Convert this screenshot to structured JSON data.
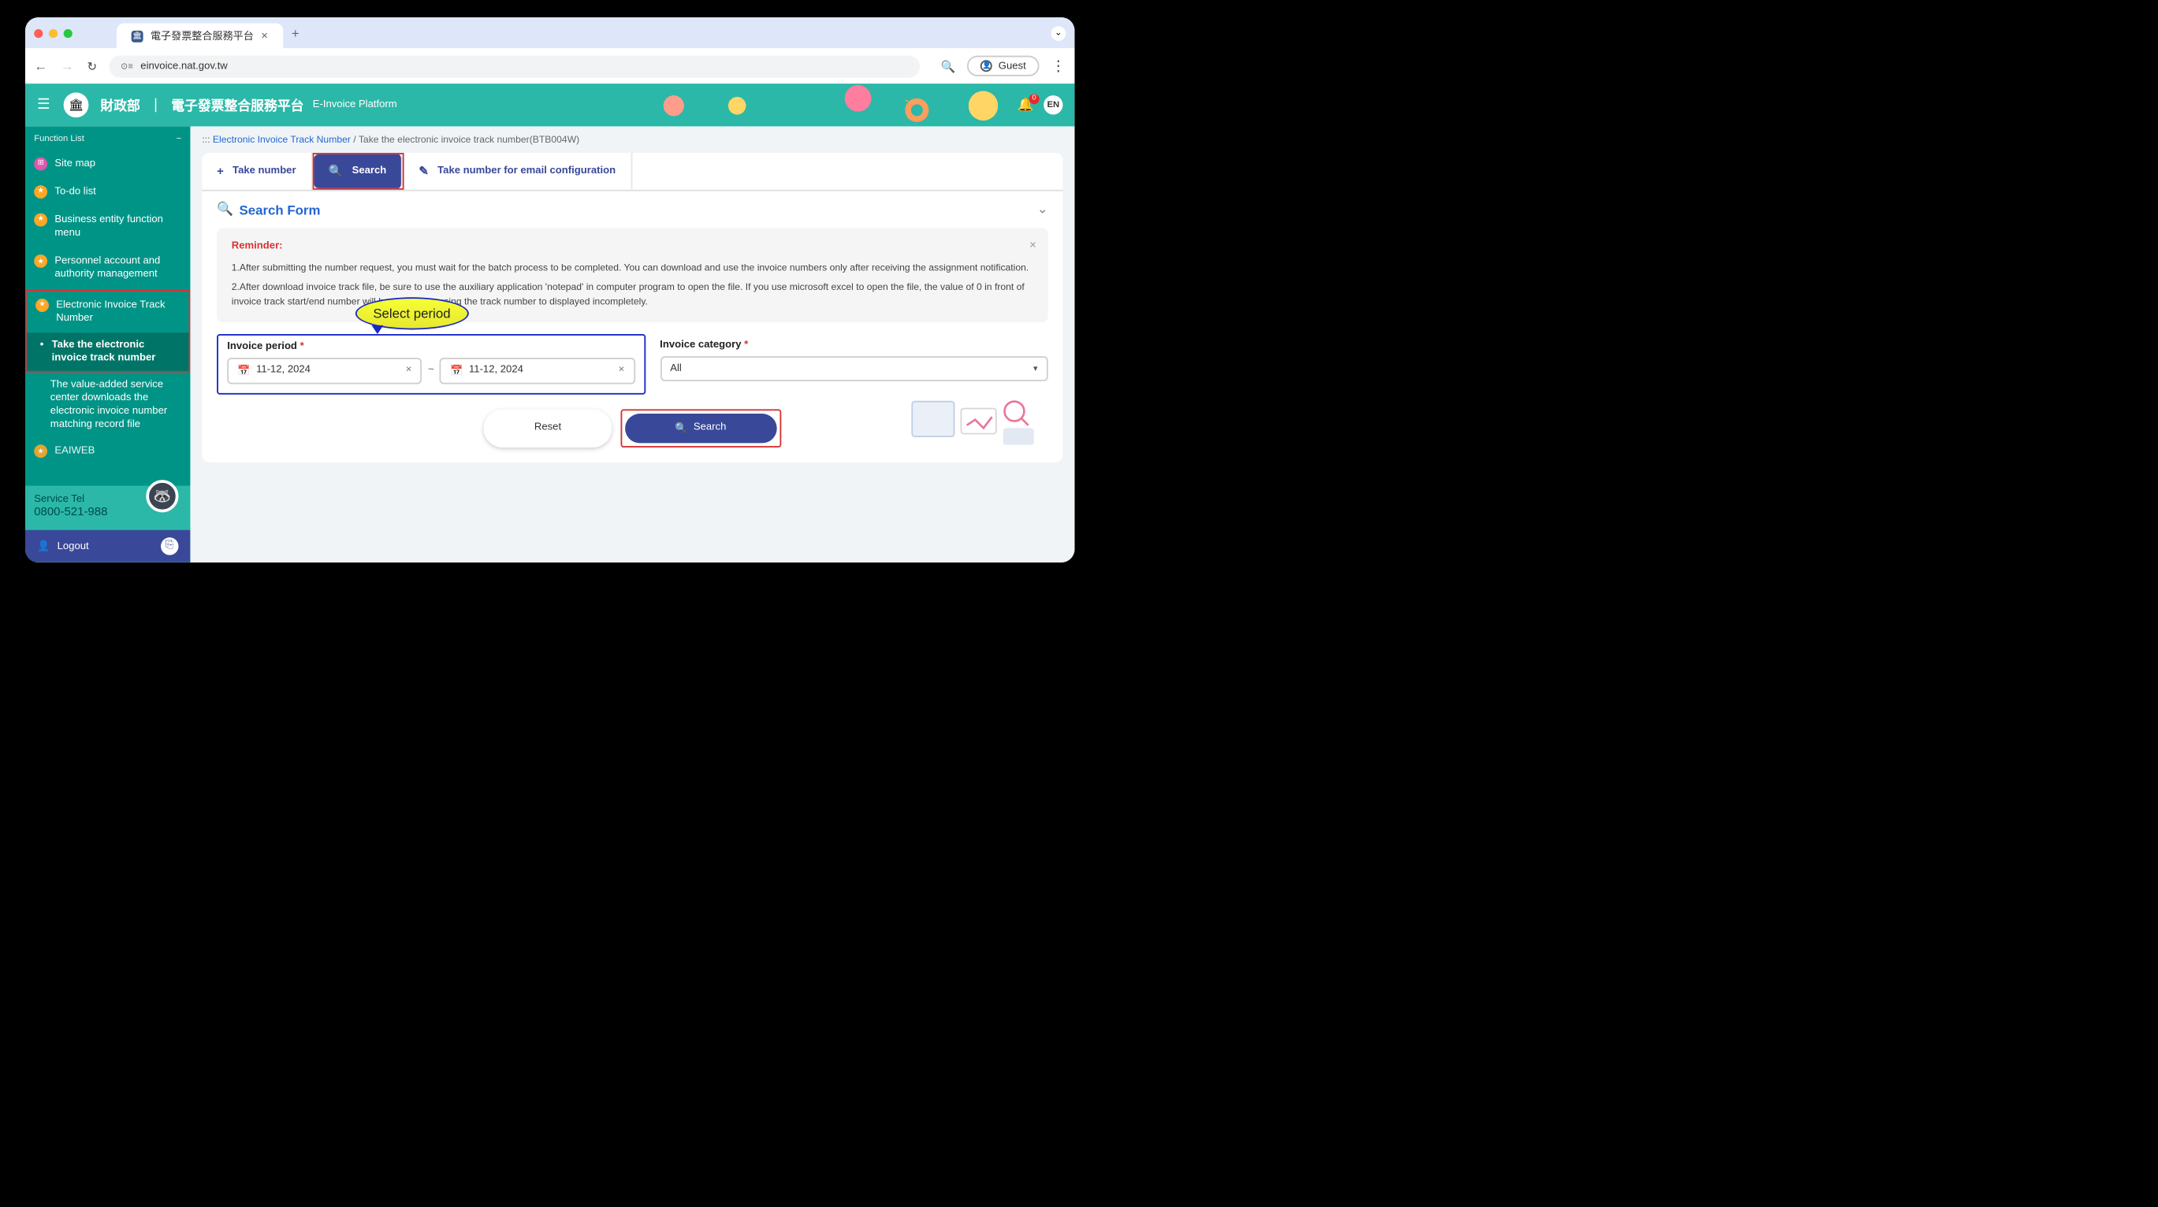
{
  "browser": {
    "tab_title": "電子發票整合服務平台",
    "url": "einvoice.nat.gov.tw",
    "guest_label": "Guest"
  },
  "header": {
    "brand_cn1": "財政部",
    "brand_cn2": "電子發票整合服務平台",
    "brand_en": "E-Invoice Platform",
    "lang": "EN",
    "notif_count": "0"
  },
  "sidebar": {
    "title": "Function List",
    "items": [
      {
        "label": "Site map"
      },
      {
        "label": "To-do list"
      },
      {
        "label": "Business entity function menu"
      },
      {
        "label": "Personnel account and authority management"
      },
      {
        "label": "Electronic Invoice Track Number",
        "children": [
          {
            "label": "Take the electronic invoice track number"
          },
          {
            "label": "The value-added service center downloads the electronic invoice number matching record file"
          }
        ]
      },
      {
        "label": "EAIWEB"
      }
    ],
    "service_label": "Service Tel",
    "service_num": "0800-521-988",
    "logout": "Logout"
  },
  "breadcrumb": {
    "prefix": ":::",
    "link": "Electronic Invoice Track Number",
    "sep": "/",
    "current": "Take the electronic invoice track number(BTB004W)"
  },
  "tabs": {
    "take": "Take number",
    "search": "Search",
    "email": "Take number for email configuration"
  },
  "section": {
    "title": "Search Form"
  },
  "reminder": {
    "title": "Reminder:",
    "line1": "1.After submitting the number request, you must wait for the batch process to be completed. You can download and use the invoice numbers only after receiving the assignment notification.",
    "line2": "2.After download invoice track file, be sure to use the auxiliary application 'notepad' in computer program to open the file. If you use microsoft excel to open the file, the value of 0 in front of invoice track start/end number will be omitted, causing the track number to displayed incompletely."
  },
  "form": {
    "period_label": "Invoice period",
    "period_from": "11-12, 2024",
    "period_to": "11-12, 2024",
    "category_label": "Invoice category",
    "category_value": "All",
    "reset": "Reset",
    "search": "Search"
  },
  "callout": "Select period"
}
